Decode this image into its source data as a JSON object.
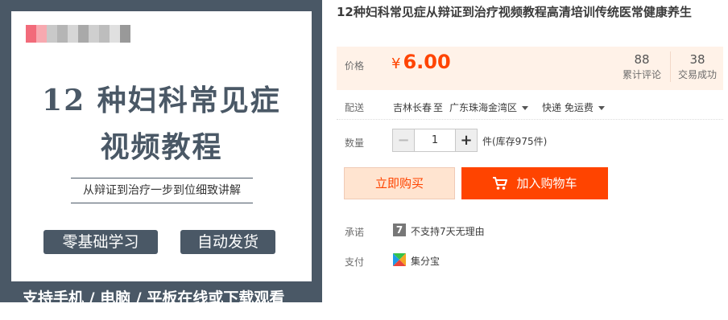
{
  "image": {
    "title_line1": "12 种妇科常见症",
    "title_line2": "视频教程",
    "subtitle": "从辩证到治疗一步到位细致讲解",
    "badge_left": "零基础学习",
    "badge_right": "自动发货",
    "footer": "支持手机 / 电脑 / 平板在线或下载观看",
    "blur_colors": [
      "#f26b7a",
      "#f7a9b0",
      "#c9c9c9",
      "#b5b5b5",
      "#d6d6d6",
      "#a9a9a9",
      "#cfcfcf",
      "#bdbdbd",
      "#e0e0e0",
      "#999999"
    ]
  },
  "product": {
    "title": "12种妇科常见症从辩证到治疗视频教程高清培训传统医常健康养生"
  },
  "price": {
    "label": "价格",
    "currency": "¥",
    "value": "6.00",
    "reviews_count": "88",
    "reviews_label": "累计评论",
    "deals_count": "38",
    "deals_label": "交易成功"
  },
  "shipping": {
    "label": "配送",
    "from": "吉林长春",
    "to_word": "至",
    "to": "广东珠海金湾区",
    "method": "快递 免运费"
  },
  "quantity": {
    "label": "数量",
    "minus": "−",
    "value": "1",
    "plus": "+",
    "stock": "件(库存975件)"
  },
  "actions": {
    "buy_now": "立即购买",
    "add_to_cart": "加入购物车"
  },
  "promise": {
    "label": "承诺",
    "icon_text": "7",
    "text": "不支持7天无理由"
  },
  "payment": {
    "label": "支付",
    "text": "集分宝"
  },
  "colors": {
    "accent": "#ff4400",
    "price_bg": "#fff2e8",
    "image_frame": "#4a5866"
  }
}
